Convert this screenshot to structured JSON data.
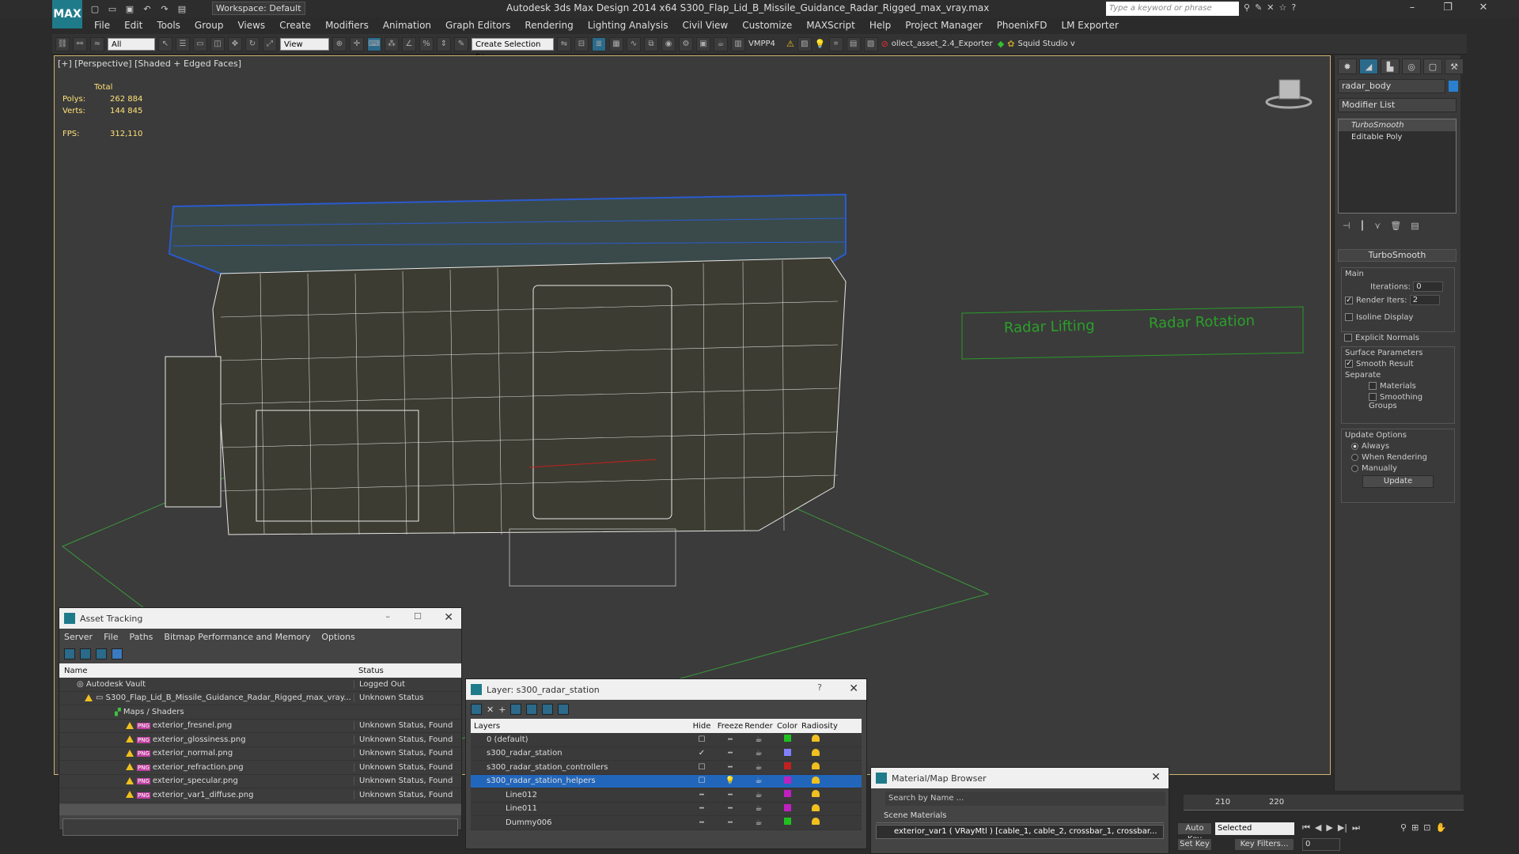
{
  "app": {
    "logo": "MAX",
    "workspace": "Workspace: Default",
    "title": "Autodesk 3ds Max Design 2014 x64     S300_Flap_Lid_B_Missile_Guidance_Radar_Rigged_max_vray.max",
    "search_placeholder": "Type a keyword or phrase",
    "menu": [
      "File",
      "Edit",
      "Tools",
      "Group",
      "Views",
      "Create",
      "Modifiers",
      "Animation",
      "Graph Editors",
      "Rendering",
      "Lighting Analysis",
      "Civil View",
      "Customize",
      "MAXScript",
      "Help",
      "Project Manager",
      "PhoenixFD",
      "LM Exporter"
    ]
  },
  "toolbar": {
    "filter": "All",
    "coord": "View",
    "selection_set": "Create Selection Se",
    "vmpp": "VMPP4",
    "exporter": "ollect_asset_2.4_Exporter",
    "squid": "Squid Studio v"
  },
  "viewport": {
    "label": "[+] [Perspective] [Shaded + Edged Faces]",
    "stats": {
      "header": "Total",
      "polys_label": "Polys:",
      "polys": "262 884",
      "verts_label": "Verts:",
      "verts": "144 845",
      "fps_label": "FPS:",
      "fps": "312,110"
    },
    "annotations": [
      "Radar Lifting",
      "Radar Rotation"
    ]
  },
  "command_panel": {
    "object_name": "radar_body",
    "object_color": "#2980d0",
    "modifier_list": "Modifier List",
    "stack": [
      "TurboSmooth",
      "Editable Poly"
    ],
    "rollout": "TurboSmooth",
    "main": "Main",
    "iterations_label": "Iterations:",
    "iterations": "0",
    "render_iters_label": "Render Iters:",
    "render_iters": "2",
    "isoline": "Isoline Display",
    "explicit": "Explicit Normals",
    "surface": "Surface Parameters",
    "smooth": "Smooth Result",
    "separate": "Separate",
    "materials": "Materials",
    "smoothing": "Smoothing Groups",
    "update_opts": "Update Options",
    "always": "Always",
    "when_rendering": "When Rendering",
    "manually": "Manually",
    "update": "Update"
  },
  "asset_tracking": {
    "title": "Asset Tracking",
    "menu": [
      "Server",
      "File",
      "Paths",
      "Bitmap Performance and Memory",
      "Options"
    ],
    "col_name": "Name",
    "col_status": "Status",
    "rows": [
      {
        "name": "Autodesk Vault",
        "status": "Logged Out"
      },
      {
        "name": "S300_Flap_Lid_B_Missile_Guidance_Radar_Rigged_max_vray...",
        "status": "Unknown Status"
      },
      {
        "name": "Maps / Shaders",
        "status": ""
      },
      {
        "name": "exterior_fresnel.png",
        "status": "Unknown Status, Found"
      },
      {
        "name": "exterior_glossiness.png",
        "status": "Unknown Status, Found"
      },
      {
        "name": "exterior_normal.png",
        "status": "Unknown Status, Found"
      },
      {
        "name": "exterior_refraction.png",
        "status": "Unknown Status, Found"
      },
      {
        "name": "exterior_specular.png",
        "status": "Unknown Status, Found"
      },
      {
        "name": "exterior_var1_diffuse.png",
        "status": "Unknown Status, Found"
      }
    ]
  },
  "layers": {
    "title": "Layer: s300_radar_station",
    "help": "?",
    "cols": [
      "Layers",
      "Hide",
      "Freeze",
      "Render",
      "Color",
      "Radiosity"
    ],
    "rows": [
      {
        "name": "0 (default)",
        "color": "#20c020"
      },
      {
        "name": "s300_radar_station",
        "color": "#8080ff"
      },
      {
        "name": "s300_radar_station_controllers",
        "color": "#c02020"
      },
      {
        "name": "s300_radar_station_helpers",
        "color": "#c020c0"
      },
      {
        "name": "Line012",
        "color": "#c020c0"
      },
      {
        "name": "Line011",
        "color": "#c020c0"
      },
      {
        "name": "Dummy006",
        "color": "#20c020"
      }
    ]
  },
  "material_browser": {
    "title": "Material/Map Browser",
    "search": "Search by Name ...",
    "section": "Scene Materials",
    "item": "exterior_var1  ( VRayMtl )  [cable_1, cable_2, crossbar_1, crossbar..."
  },
  "timeline": {
    "ticks": [
      "210",
      "220"
    ],
    "auto_key": "Auto Key",
    "set_key": "Set Key",
    "selected": "Selected",
    "key_filters": "Key Filters...",
    "frame": "0"
  }
}
